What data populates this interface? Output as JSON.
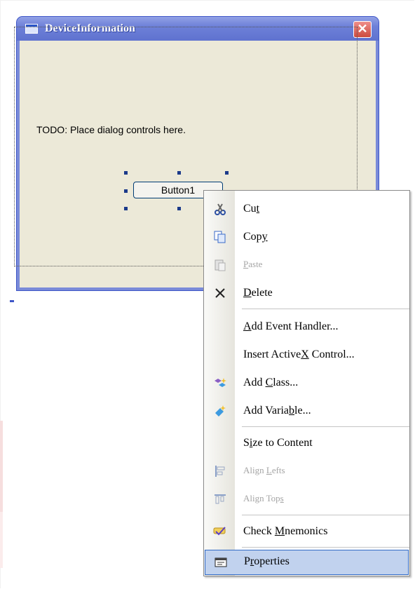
{
  "dialog": {
    "title": "DeviceInformation",
    "close_glyph": "✕",
    "todo_text": "TODO: Place dialog controls here.",
    "button_label": "Button1"
  },
  "context_menu": {
    "items": [
      {
        "pre": "Cu",
        "u": "t",
        "post": "",
        "icon": "scissors-icon",
        "enabled": true
      },
      {
        "pre": "Cop",
        "u": "y",
        "post": "",
        "icon": "copy-icon",
        "enabled": true
      },
      {
        "pre": "",
        "u": "P",
        "post": "aste",
        "icon": "paste-icon",
        "enabled": false
      },
      {
        "pre": "",
        "u": "D",
        "post": "elete",
        "icon": "delete-x-icon",
        "enabled": true
      },
      {
        "pre": "",
        "u": "A",
        "post": "dd Event Handler...",
        "icon": null,
        "enabled": true
      },
      {
        "pre": "Insert Active",
        "u": "X",
        "post": " Control...",
        "icon": null,
        "enabled": true
      },
      {
        "pre": "Add ",
        "u": "C",
        "post": "lass...",
        "icon": "add-class-icon",
        "enabled": true
      },
      {
        "pre": "Add Varia",
        "u": "b",
        "post": "le...",
        "icon": "add-variable-icon",
        "enabled": true
      },
      {
        "pre": "S",
        "u": "i",
        "post": "ze to Content",
        "icon": null,
        "enabled": true
      },
      {
        "pre": "Align ",
        "u": "L",
        "post": "efts",
        "icon": "align-lefts-icon",
        "enabled": false
      },
      {
        "pre": "Align Top",
        "u": "s",
        "post": "",
        "icon": "align-tops-icon",
        "enabled": false
      },
      {
        "pre": "Check ",
        "u": "M",
        "post": "nemonics",
        "icon": "check-mnemonics-icon",
        "enabled": true
      },
      {
        "pre": "P",
        "u": "r",
        "post": "operties",
        "icon": "properties-icon",
        "enabled": true,
        "selected": true
      }
    ]
  },
  "colors": {
    "title_bar": "#6d80d8",
    "dialog_face": "#ece9d8",
    "menu_highlight": "#c1d2ee",
    "close_button": "#cc4a3e"
  }
}
